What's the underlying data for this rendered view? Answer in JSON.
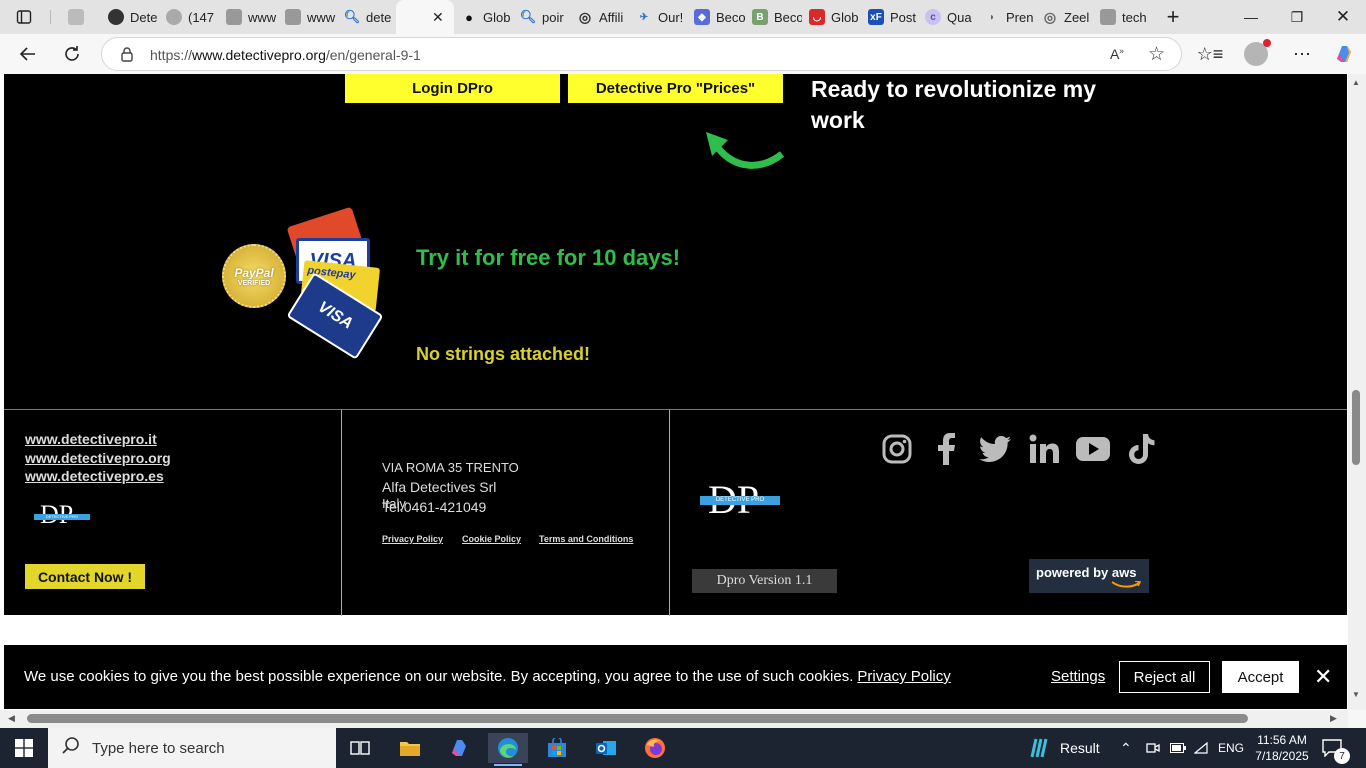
{
  "browser": {
    "tabs": [
      {
        "label": "Dete",
        "color": "#444"
      },
      {
        "label": "(147",
        "color": "#888"
      },
      {
        "label": "www",
        "color": "#666"
      },
      {
        "label": "www",
        "color": "#666"
      },
      {
        "label": "dete",
        "color": "#2b6fd6"
      },
      {
        "label": "",
        "color": "#ffffff"
      },
      {
        "label": "Glob",
        "color": "#111"
      },
      {
        "label": "poir",
        "color": "#2b6fd6"
      },
      {
        "label": "Affili",
        "color": "#333"
      },
      {
        "label": "Our!",
        "color": "#2b6fd6"
      },
      {
        "label": "Beco",
        "color": "#5a6bd8"
      },
      {
        "label": "Beco",
        "color": "#7aa070"
      },
      {
        "label": "Glob",
        "color": "#d92a2a"
      },
      {
        "label": "Post",
        "color": "#1a4fb8"
      },
      {
        "label": "Qua",
        "color": "#8a7fd0"
      },
      {
        "label": "Pren",
        "color": "#666"
      },
      {
        "label": "Zeel",
        "color": "#666"
      },
      {
        "label": "tech",
        "color": "#666"
      }
    ],
    "url_prefix": "https://",
    "url_host": "www.detectivepro.org",
    "url_path": "/en/general-9-1"
  },
  "hero": {
    "login_button": "Login DPro",
    "prices_button": "Detective Pro \"Prices\"",
    "ready_text": "Ready to revolutionize my work",
    "paypal_badge_top": "PayPal",
    "paypal_badge_bottom": "VERIFIED",
    "try_text": "Try it for free for 10 days!",
    "no_strings": "No strings attached!"
  },
  "footer": {
    "links": [
      "www.detectivepro.it",
      "www.detectivepro.org",
      "www.detectivepro.es"
    ],
    "contact_button": "Contact Now !",
    "address_line1": "VIA ROMA 35 TRENTO",
    "address_line2": "Alfa Detectives Srl",
    "address_line3": "Italy",
    "phone": "Tel.0461-421049",
    "privacy": "Privacy Policy",
    "cookie": "Cookie Policy",
    "terms": "Terms and Conditions",
    "logo_text": "DP",
    "logo_band": "DETECTIVE PRO",
    "version": "Dpro Version 1.1",
    "aws": "powered by aws"
  },
  "cookie_banner": {
    "message": "We use cookies to give you the best possible experience on our website. By accepting, you agree to the use of such cookies.",
    "privacy_link": "Privacy Policy",
    "settings": "Settings",
    "reject": "Reject all",
    "accept": "Accept"
  },
  "taskbar": {
    "search_placeholder": "Type here to search",
    "weather": "Result",
    "lang": "ENG",
    "time": "11:56 AM",
    "date": "7/18/2025",
    "notifications": "7"
  }
}
